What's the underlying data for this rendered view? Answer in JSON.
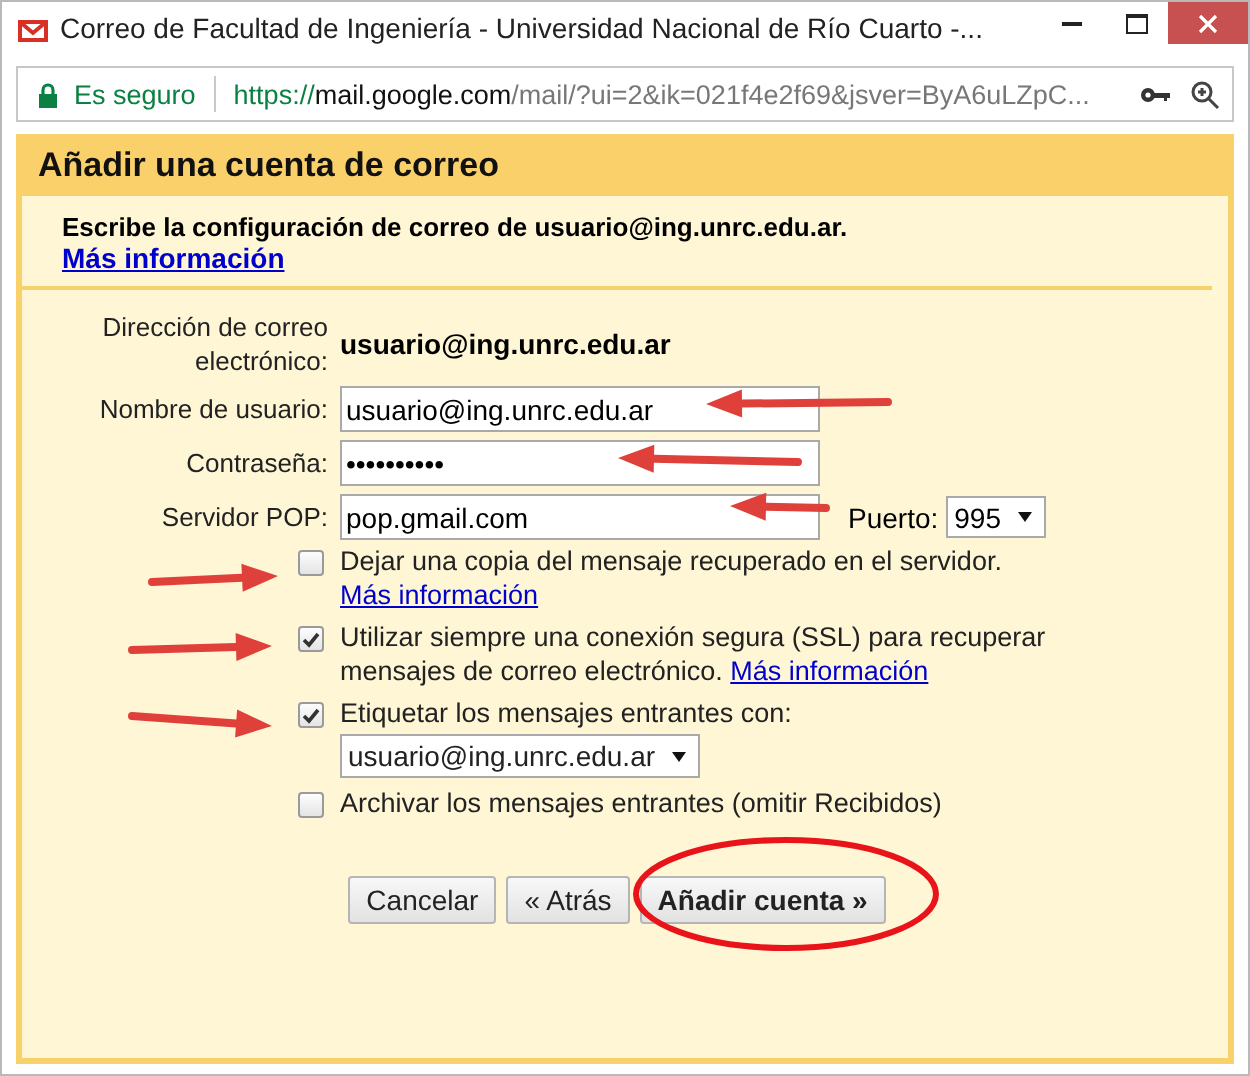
{
  "window": {
    "title": "Correo de Facultad de Ingeniería - Universidad Nacional de Río Cuarto -..."
  },
  "address_bar": {
    "security": "Es seguro",
    "url_scheme": "https://",
    "url_host": "mail.google.com",
    "url_path": "/mail/?ui=2&ik=021f4e2f69&jsver=ByA6uLZpC..."
  },
  "dialog": {
    "title": "Añadir una cuenta de correo",
    "intro": "Escribe la configuración de correo de usuario@ing.unrc.edu.ar.",
    "intro_link": "Más información",
    "fields": [
      {
        "kind": "static",
        "label": "Dirección de correo electrónico:",
        "value": "usuario@ing.unrc.edu.ar"
      },
      {
        "kind": "text",
        "label": "Nombre de usuario:",
        "value": "usuario@ing.unrc.edu.ar"
      },
      {
        "kind": "password",
        "label": "Contraseña:",
        "value": "••••••••••"
      },
      {
        "kind": "text",
        "label": "Servidor POP:",
        "value": "pop.gmail.com",
        "port_label": "Puerto:",
        "port": "995"
      }
    ],
    "options": [
      {
        "label": "Dejar una copia del mensaje recuperado en el servidor.",
        "link": "Más información",
        "checked": false
      },
      {
        "label": "Utilizar siempre una conexión segura (SSL) para recuperar mensajes de correo electrónico.",
        "link": "Más información",
        "checked": true
      },
      {
        "label": "Etiquetar los mensajes entrantes con:",
        "select": "usuario@ing.unrc.edu.ar",
        "checked": true
      },
      {
        "label": "Archivar los mensajes entrantes (omitir Recibidos)",
        "checked": false
      }
    ],
    "buttons": [
      {
        "label": "Cancelar",
        "primary": false
      },
      {
        "label": "« Atrás",
        "primary": false
      },
      {
        "label": "Añadir cuenta »",
        "primary": true
      }
    ]
  }
}
